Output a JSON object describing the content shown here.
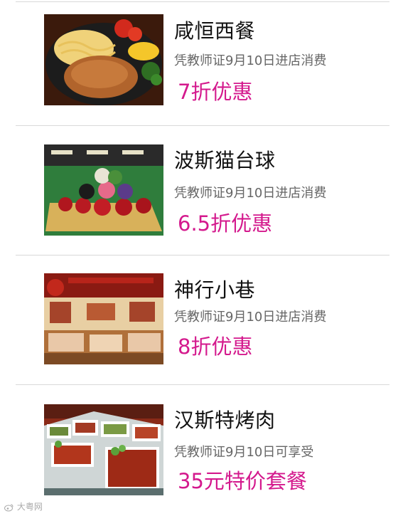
{
  "deals": [
    {
      "name": "咸恒西餐",
      "condition": "凭教师证9月10日进店消费",
      "offer": "7折优惠",
      "image_icon": "steak-plate-image"
    },
    {
      "name": "波斯猫台球",
      "condition": "凭教师证9月10日进店消费",
      "offer": "6.5折优惠",
      "image_icon": "billiards-balls-image"
    },
    {
      "name": "神行小巷",
      "condition": "凭教师证9月10日进店消费",
      "offer": "8折优惠",
      "image_icon": "restaurant-interior-image"
    },
    {
      "name": "汉斯特烤肉",
      "condition": "凭教师证9月10日可享受",
      "offer": "35元特价套餐",
      "image_icon": "buffet-meat-image"
    }
  ],
  "watermark": {
    "text": "大粤网",
    "icon": "weibo-icon"
  },
  "colors": {
    "offer": "#d4198d",
    "divider": "#d9d9d9",
    "condition": "#666666"
  }
}
